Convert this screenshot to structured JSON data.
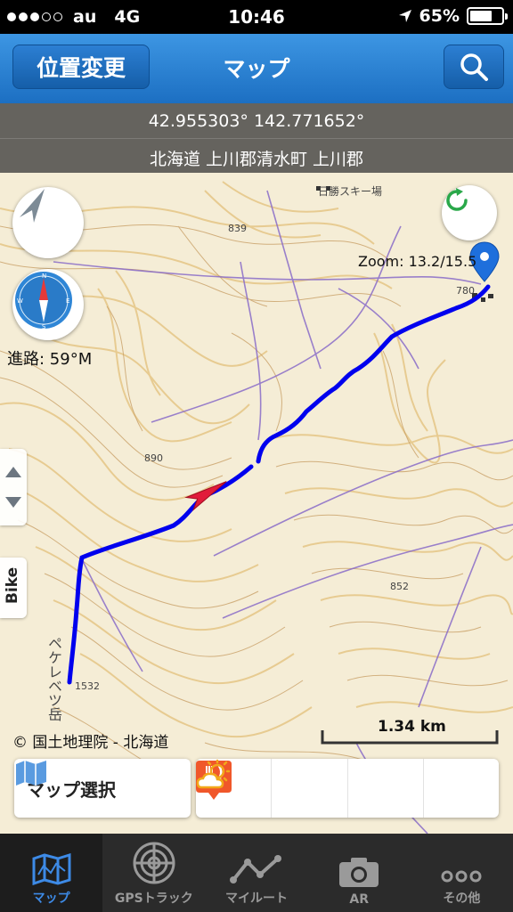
{
  "status_bar": {
    "carrier": "au",
    "network": "4G",
    "time": "10:46",
    "battery": "65%",
    "battery_level": 0.65,
    "signal_bars": 3
  },
  "nav": {
    "location_button": "位置変更",
    "title": "マップ",
    "search_icon": "search-icon"
  },
  "info": {
    "coordinates": "42.955303° 142.771652°",
    "address": "北海道 上川郡清水町 上川郡"
  },
  "map": {
    "heading_label": "進路: 59°M",
    "zoom_label": "Zoom: 13.2/15.5",
    "side_tab_label": "Bike",
    "scale_label": "1.34 km",
    "copyright": "© 国土地理院 - 北海道",
    "features": [
      "日勝スキー場",
      "839",
      "890",
      "852",
      "1532",
      "ペケレベツ岳",
      "780"
    ],
    "track_color": "#0000ee",
    "marker_color": "#e11b3a",
    "pin_color": "#1e6fdc"
  },
  "bottom": {
    "map_select": "マップ選択",
    "tools": [
      {
        "name": "save-icon",
        "color": "#1a5fc8"
      },
      {
        "name": "plus-icon",
        "color": "#2aa84a"
      },
      {
        "name": "restaurant-icon",
        "color": "#f0572a"
      },
      {
        "name": "weather-icon",
        "color": "#f2a81a"
      }
    ]
  },
  "tabs": [
    {
      "label": "マップ",
      "icon": "map-icon",
      "active": true
    },
    {
      "label": "GPSトラック",
      "icon": "radar-icon",
      "active": false
    },
    {
      "label": "マイルート",
      "icon": "route-icon",
      "active": false
    },
    {
      "label": "AR",
      "icon": "camera-icon",
      "active": false
    },
    {
      "label": "その他",
      "icon": "more-icon",
      "active": false
    }
  ]
}
